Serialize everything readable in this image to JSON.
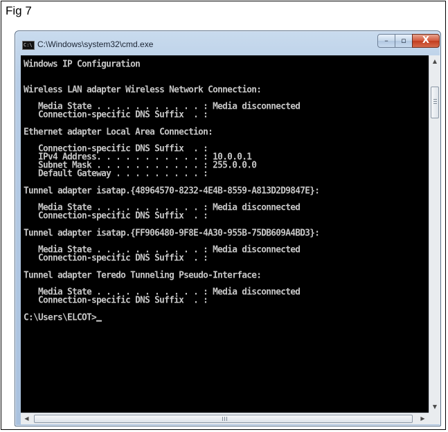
{
  "figure": {
    "label": "Fig 7"
  },
  "window": {
    "title": "C:\\Windows\\system32\\cmd.exe",
    "icon": "console-app-icon",
    "icon_text": "C:\\",
    "controls": {
      "minimize": "–",
      "maximize": "▫",
      "close": "X"
    }
  },
  "console": {
    "lines": [
      "Windows IP Configuration",
      "",
      "",
      "Wireless LAN adapter Wireless Network Connection:",
      "",
      "   Media State . . . . . . . . . . . : Media disconnected",
      "   Connection-specific DNS Suffix  . :",
      "",
      "Ethernet adapter Local Area Connection:",
      "",
      "   Connection-specific DNS Suffix  . :",
      "   IPv4 Address. . . . . . . . . . . : 10.0.0.1",
      "   Subnet Mask . . . . . . . . . . . : 255.0.0.0",
      "   Default Gateway . . . . . . . . . :",
      "",
      "Tunnel adapter isatap.{48964570-8232-4E4B-8559-A813D2D9847E}:",
      "",
      "   Media State . . . . . . . . . . . : Media disconnected",
      "   Connection-specific DNS Suffix  . :",
      "",
      "Tunnel adapter isatap.{FF906480-9F8E-4A30-955B-75DB609A4BD3}:",
      "",
      "   Media State . . . . . . . . . . . : Media disconnected",
      "   Connection-specific DNS Suffix  . :",
      "",
      "Tunnel adapter Teredo Tunneling Pseudo-Interface:",
      "",
      "   Media State . . . . . . . . . . . : Media disconnected",
      "   Connection-specific DNS Suffix  . :",
      "",
      "C:\\Users\\ELCOT>"
    ]
  },
  "scrollbars": {
    "vertical": {
      "up_arrow": "▲",
      "down_arrow": "▼"
    },
    "horizontal": {
      "left_arrow": "◀",
      "right_arrow": "▶"
    }
  },
  "colors": {
    "console_bg": "#000000",
    "console_text": "#c0c0c0",
    "close_button": "#c7472b",
    "titlebar": "#b9d1ea"
  }
}
